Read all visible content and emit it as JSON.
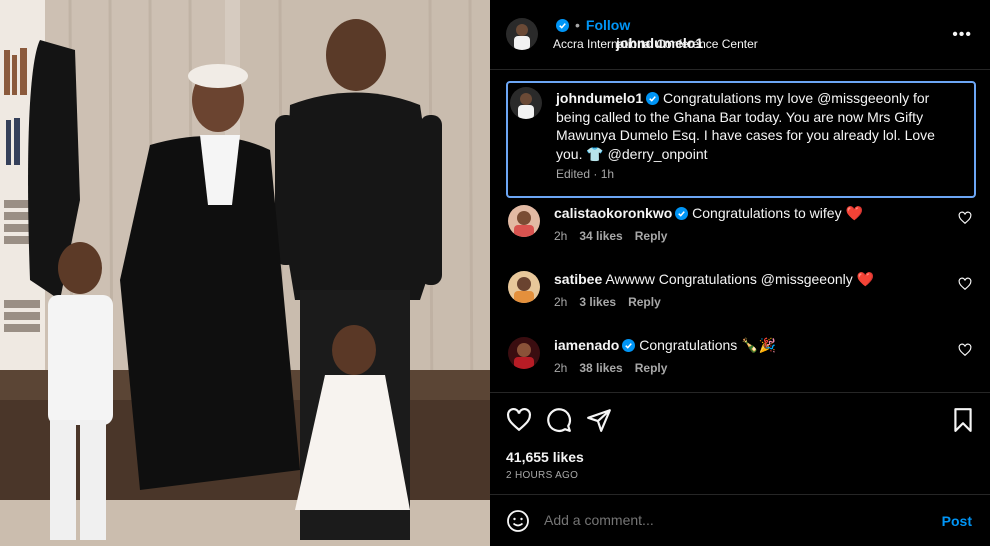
{
  "post": {
    "username": "johndumelo1",
    "verified": true,
    "follow_label": "Follow",
    "separator": "•",
    "location": "Accra International Conference Center",
    "more_icon": "more-horizontal-icon"
  },
  "caption": {
    "username": "johndumelo1",
    "text": "Congratulations my love @missgeeonly for being called to the Ghana Bar today. You are now Mrs Gifty Mawunya Dumelo Esq. I have cases for you already lol. Love you. 👕 @derry_onpoint",
    "meta": "Edited · 1h"
  },
  "comments": [
    {
      "username": "calistaokoronkwo",
      "verified": true,
      "text": "Congratulations to wifey ❤️",
      "time": "2h",
      "likes": "34 likes",
      "reply": "Reply"
    },
    {
      "username": "satibee",
      "verified": false,
      "text": "Awwww Congratulations @missgeeonly ❤️",
      "time": "2h",
      "likes": "3 likes",
      "reply": "Reply"
    },
    {
      "username": "iamenado",
      "verified": true,
      "text": "Congratulations 🍾🎉",
      "time": "2h",
      "likes": "38 likes",
      "reply": "Reply"
    }
  ],
  "actions": {
    "icons": [
      "heart-icon",
      "comment-icon",
      "share-icon",
      "bookmark-icon"
    ],
    "likes": "41,655 likes",
    "time_ago": "2 HOURS AGO"
  },
  "add_comment": {
    "placeholder": "Add a comment...",
    "post_label": "Post"
  },
  "colors": {
    "accent": "#0095f6",
    "background": "#000000",
    "highlight_border": "#6ca6f5",
    "secondary_text": "#a8a8a8"
  }
}
